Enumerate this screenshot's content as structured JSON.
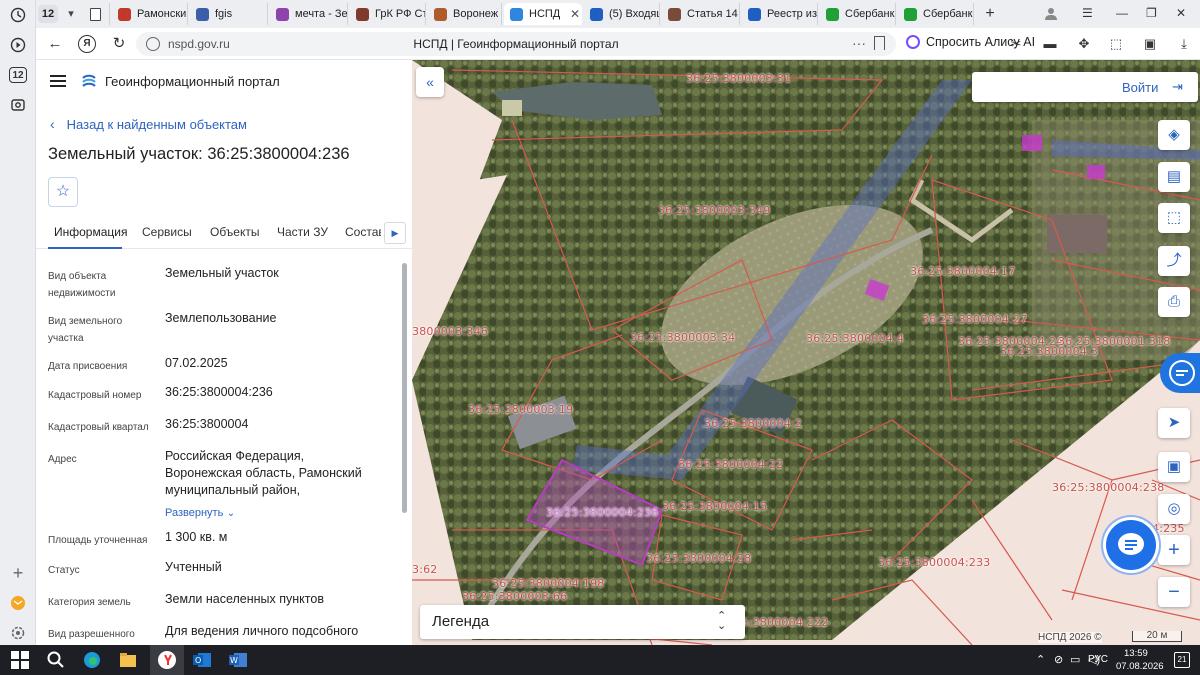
{
  "browser": {
    "tab_count_badge": "12",
    "tabs": [
      {
        "title": "Рамонский",
        "color": "#c0392b"
      },
      {
        "title": "fgis",
        "color": "#3a5fa8"
      },
      {
        "title": "мечта - Зе",
        "color": "#8e44ad"
      },
      {
        "title": "ГрК РФ Ст",
        "color": "#7f3b2b"
      },
      {
        "title": "Воронеж",
        "color": "#b05b2a"
      },
      {
        "title": "НСПД",
        "color": "#2e86de"
      },
      {
        "title": "(5) Входящ",
        "color": "#1f5fbf"
      },
      {
        "title": "Статья 14",
        "color": "#7a4a3a"
      },
      {
        "title": "Реестр из",
        "color": "#1f5fbf"
      },
      {
        "title": "Сбербанк",
        "color": "#21a038"
      },
      {
        "title": "Сбербанк",
        "color": "#21a038"
      }
    ],
    "url": "nspd.gov.ru",
    "page_title": "НСПД | Геоинформационный портал",
    "alisa_label": "Спросить Алису AI",
    "side_badge": "12"
  },
  "panel": {
    "brand": "Геоинформационный портал",
    "back_link": "Назад к найденным объектам",
    "object_title": "Земельный участок: 36:25:3800004:236",
    "tabs": [
      "Информация",
      "Сервисы",
      "Объекты",
      "Части ЗУ",
      "Состав"
    ],
    "fields": [
      {
        "label": "Вид объекта недвижимости",
        "value": "Земельный участок"
      },
      {
        "label": "Вид земельного участка",
        "value": "Землепользование"
      },
      {
        "label": "Дата присвоения",
        "value": "07.02.2025"
      },
      {
        "label": "Кадастровый номер",
        "value": "36:25:3800004:236"
      },
      {
        "label": "Кадастровый квартал",
        "value": "36:25:3800004"
      },
      {
        "label": "Адрес",
        "value": "Российская Федерация, Воронежская область, Рамонский муниципальный район,"
      },
      {
        "label": "Площадь уточненная",
        "value": "1 300 кв. м"
      },
      {
        "label": "Статус",
        "value": "Учтенный"
      },
      {
        "label": "Категория земель",
        "value": "Земли населенных пунктов"
      },
      {
        "label": "Вид разрешенного",
        "value": "Для ведения личного подсобного"
      }
    ],
    "expand_label": "Развернуть"
  },
  "map": {
    "login_label": "Войти",
    "legend_label": "Легенда",
    "copyright": "НСПД 2026 ©",
    "scale": "20 м",
    "parcel_labels": [
      "36:25:3800003:31",
      "36:25:3800003:349",
      "36:25:3800004:17",
      "36:25:3800004:27",
      "36:25:3800004:24",
      "36:25:3800001:318",
      "36:25:3800004:4",
      "3800003:346",
      "36:25:3800003:34",
      "36:25:3800003:19",
      "36:25:3800004:2",
      "36:25:3800004:22",
      "36:25:3800004:236",
      "36:25:3800004:15",
      "36:25:3800004:28",
      "36:25:3800004:238",
      "36:25:3800004:233",
      "36:25:3800004:198",
      "36:25:3800003:66",
      "36:25:3800004:222",
      "3:62",
      "4:235",
      "36:25:3800004:3"
    ]
  },
  "taskbar": {
    "lang": "РУС",
    "time": "13:59",
    "date": "07.08.2026",
    "notif": "21"
  }
}
